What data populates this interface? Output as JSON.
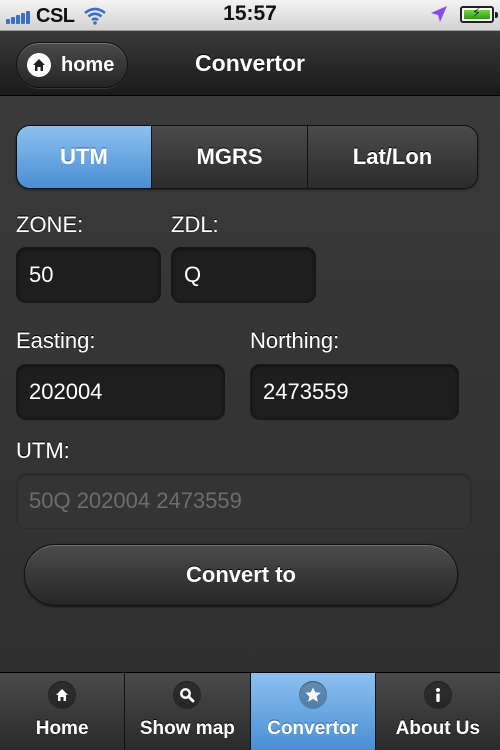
{
  "status_bar": {
    "carrier": "CSL",
    "time": "15:57",
    "signal_bars": 5,
    "icons": [
      "signal-icon",
      "wifi-icon",
      "location-arrow-icon",
      "battery-charging-icon"
    ]
  },
  "nav": {
    "home_label": "home",
    "home_icon": "home-icon",
    "title": "Convertor"
  },
  "segments": [
    {
      "label": "UTM",
      "active": true
    },
    {
      "label": "MGRS",
      "active": false
    },
    {
      "label": "Lat/Lon",
      "active": false
    }
  ],
  "form": {
    "zone_label": "ZONE:",
    "zone_value": "50",
    "zdl_label": "ZDL:",
    "zdl_value": "Q",
    "easting_label": "Easting:",
    "easting_value": "202004",
    "northing_label": "Northing:",
    "northing_value": "2473559",
    "utm_label": "UTM:",
    "utm_value": "50Q 202004 2473559"
  },
  "convert_button": "Convert to",
  "tabs": [
    {
      "label": "Home",
      "icon": "home-icon",
      "active": false
    },
    {
      "label": "Show map",
      "icon": "search-icon",
      "active": false
    },
    {
      "label": "Convertor",
      "icon": "star-icon",
      "active": true
    },
    {
      "label": "About Us",
      "icon": "info-icon",
      "active": false
    }
  ],
  "colors": {
    "accent": "#4a8fd3",
    "background": "#3c3c3c",
    "field": "#1e1e1e"
  }
}
